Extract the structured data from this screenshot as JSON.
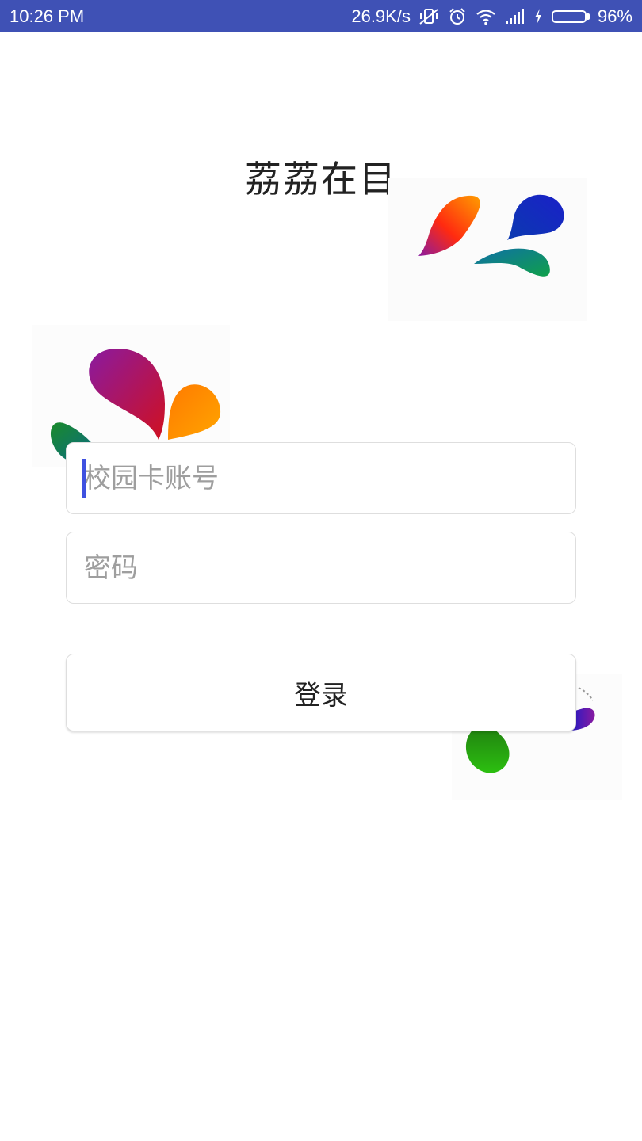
{
  "status_bar": {
    "time": "10:26  PM",
    "network_speed": "26.9K/s",
    "battery_percent": "96%",
    "battery_level": 0.96,
    "icons": [
      "vibrate-off-icon",
      "alarm-icon",
      "wifi-icon",
      "signal-icon",
      "charging-icon",
      "battery-icon"
    ],
    "background": "#3f51b5"
  },
  "app": {
    "title": "荔荔在目"
  },
  "form": {
    "account_placeholder": "校园卡账号",
    "password_placeholder": "密码",
    "login_label": "登录"
  },
  "colors": {
    "accent": "#3f51e0",
    "battery_fill": "#5cd11e"
  }
}
